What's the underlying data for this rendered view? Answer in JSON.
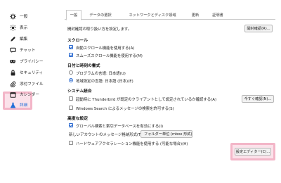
{
  "sidebar": {
    "items": [
      {
        "label": "一般",
        "icon": "gear-icon"
      },
      {
        "label": "表示",
        "icon": "sun-icon"
      },
      {
        "label": "編集",
        "icon": "pencil-icon"
      },
      {
        "label": "チャット",
        "icon": "chat-bubble-icon"
      },
      {
        "label": "プライバシー",
        "icon": "mask-icon"
      },
      {
        "label": "セキュリティ",
        "icon": "lock-icon"
      },
      {
        "label": "添付ファイル",
        "icon": "paperclip-icon"
      },
      {
        "label": "カレンダー",
        "icon": "calendar-icon"
      },
      {
        "label": "詳細",
        "icon": "flask-icon",
        "active": true
      }
    ]
  },
  "tabs": [
    "一般",
    "データの選択",
    "ネットワークとディスク領域",
    "更新",
    "証明書"
  ],
  "main": {
    "return_receipts": {
      "text": "開封確認の取り扱い方を設定します。",
      "button": "開封確認(R)..."
    },
    "scroll": {
      "heading": "スクロール",
      "auto_scroll": {
        "label": "自動スクロール機能を使用する(A)",
        "checked": true
      },
      "smooth_scroll": {
        "label": "スムーズスクロール機能を使用する(M)",
        "checked": true
      }
    },
    "datetime": {
      "heading": "日付と時刻の書式",
      "app_locale": {
        "label": "プログラムの言語: 日本語(U)",
        "selected": false
      },
      "regional_locale": {
        "label": "地域設定の言語: 日本語 (日本)(E)",
        "selected": true
      }
    },
    "system": {
      "heading": "システム統合",
      "default_client": {
        "label": "起動時に Thunderbird が既定のクライアントとして設定されているか確認する(A)",
        "checked": false
      },
      "check_now_button": "今すぐ確認(N)...",
      "windows_search": {
        "label": "Windows Search によるメッセージの検索を許可する(S)",
        "checked": false
      }
    },
    "config": {
      "heading": "高度な設定",
      "global_search": {
        "label": "グローバル検索と索引データベースを有効にする(I)",
        "checked": true
      },
      "storage_label": "新しいアカウントのメッセージ格納形式(T):",
      "storage_value": "フォルダー単位 (mbox 形式)",
      "hw_accel": {
        "label": "ハードウェアアクセラレーション機能を使用する (可能な場合)(H)",
        "checked": false
      },
      "config_editor_button": "設定エディター(C)..."
    }
  },
  "colors": {
    "accent": "#2b6ad0",
    "highlight": "#f3b6c8",
    "active_text": "#2470d8"
  }
}
